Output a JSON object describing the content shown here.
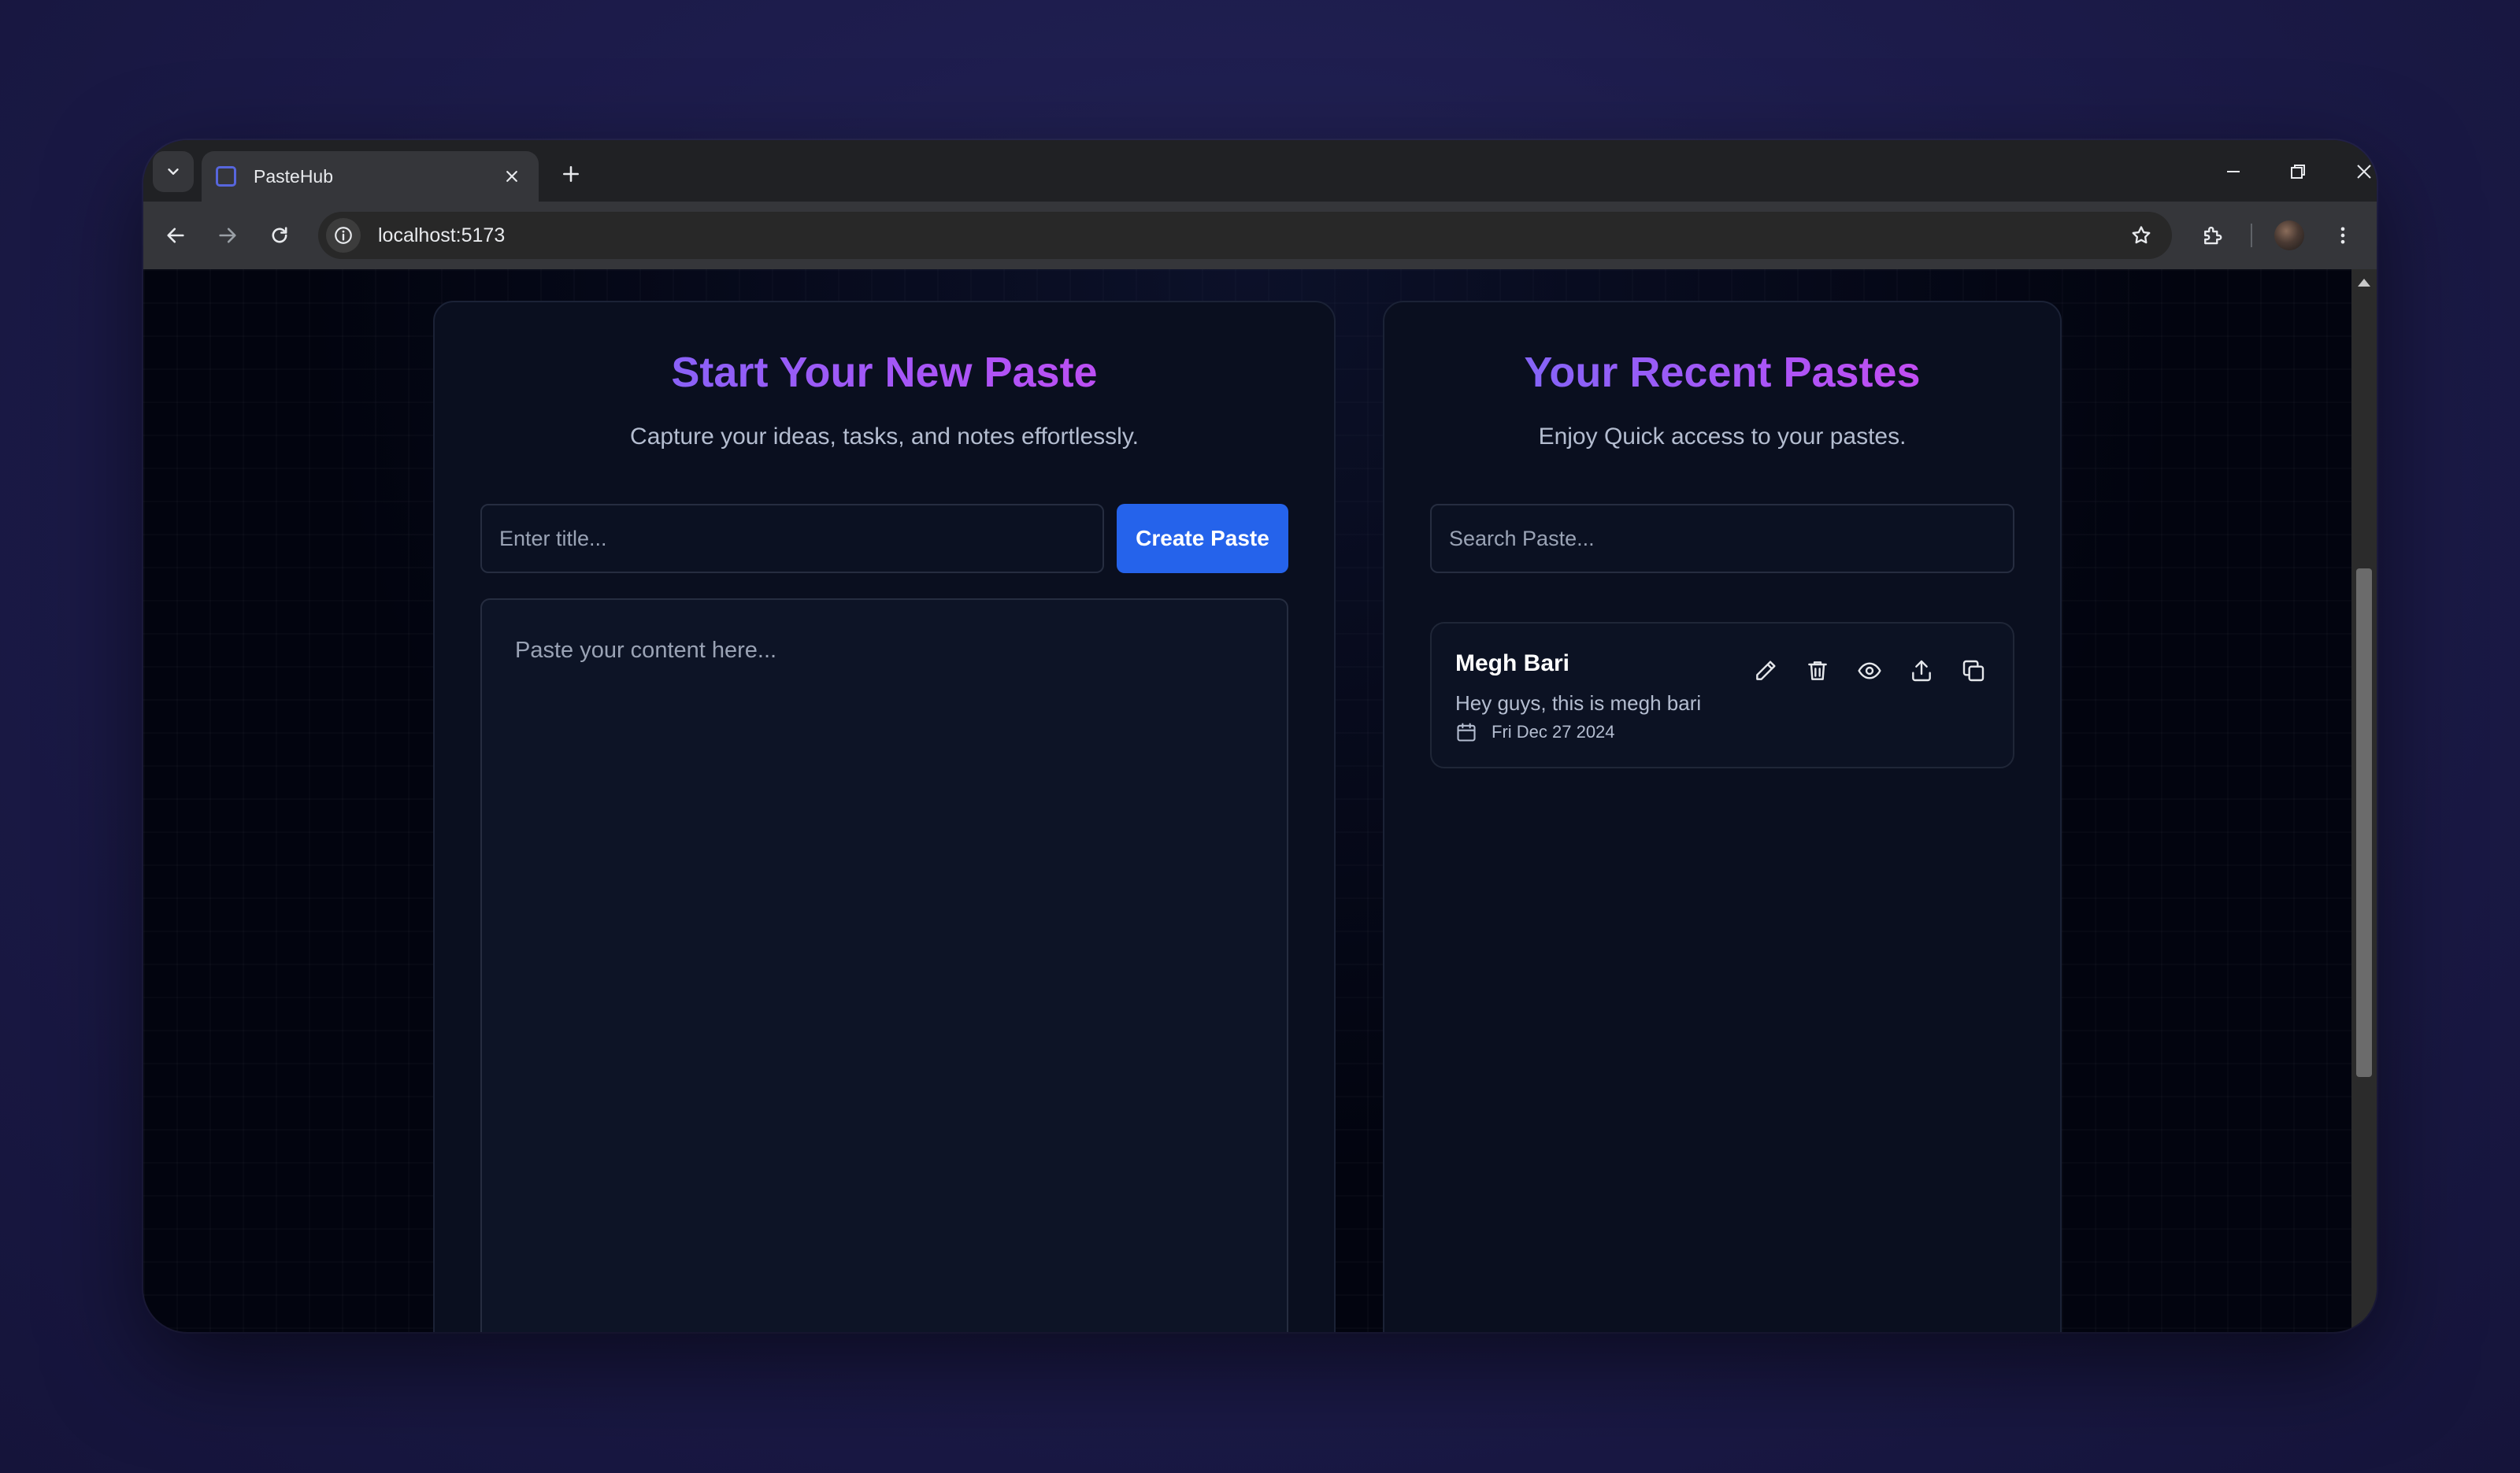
{
  "browser": {
    "tab_title": "PasteHub",
    "url": "localhost:5173",
    "icons": [
      "tab-search-icon",
      "close-icon",
      "plus-icon",
      "minimize-icon",
      "restore-icon",
      "window-close-icon",
      "back-arrow-icon",
      "forward-arrow-icon",
      "reload-icon",
      "site-info-icon",
      "star-icon",
      "extensions-icon",
      "profile-avatar",
      "more-vert-icon"
    ]
  },
  "create": {
    "title": "Start Your New Paste",
    "subtitle": "Capture your ideas, tasks, and notes effortlessly.",
    "title_placeholder": "Enter title...",
    "title_value": "",
    "button_label": "Create Paste",
    "content_placeholder": "Paste your content here...",
    "content_value": ""
  },
  "recent": {
    "title": "Your Recent Pastes",
    "subtitle": "Enjoy Quick access to your pastes.",
    "search_placeholder": "Search Paste...",
    "search_value": "",
    "pastes": [
      {
        "title": "Megh Bari",
        "content": "Hey guys, this is megh bari",
        "date": "Fri Dec 27 2024",
        "action_icons": [
          "edit-icon",
          "delete-icon",
          "view-icon",
          "share-icon",
          "copy-icon"
        ]
      }
    ]
  },
  "colors": {
    "accent_button": "#2563eb",
    "title_gradient_start": "#6f6df7",
    "title_gradient_end": "#d946ef",
    "page_background": "#02040f",
    "panel_background": "#0a0f1f"
  }
}
